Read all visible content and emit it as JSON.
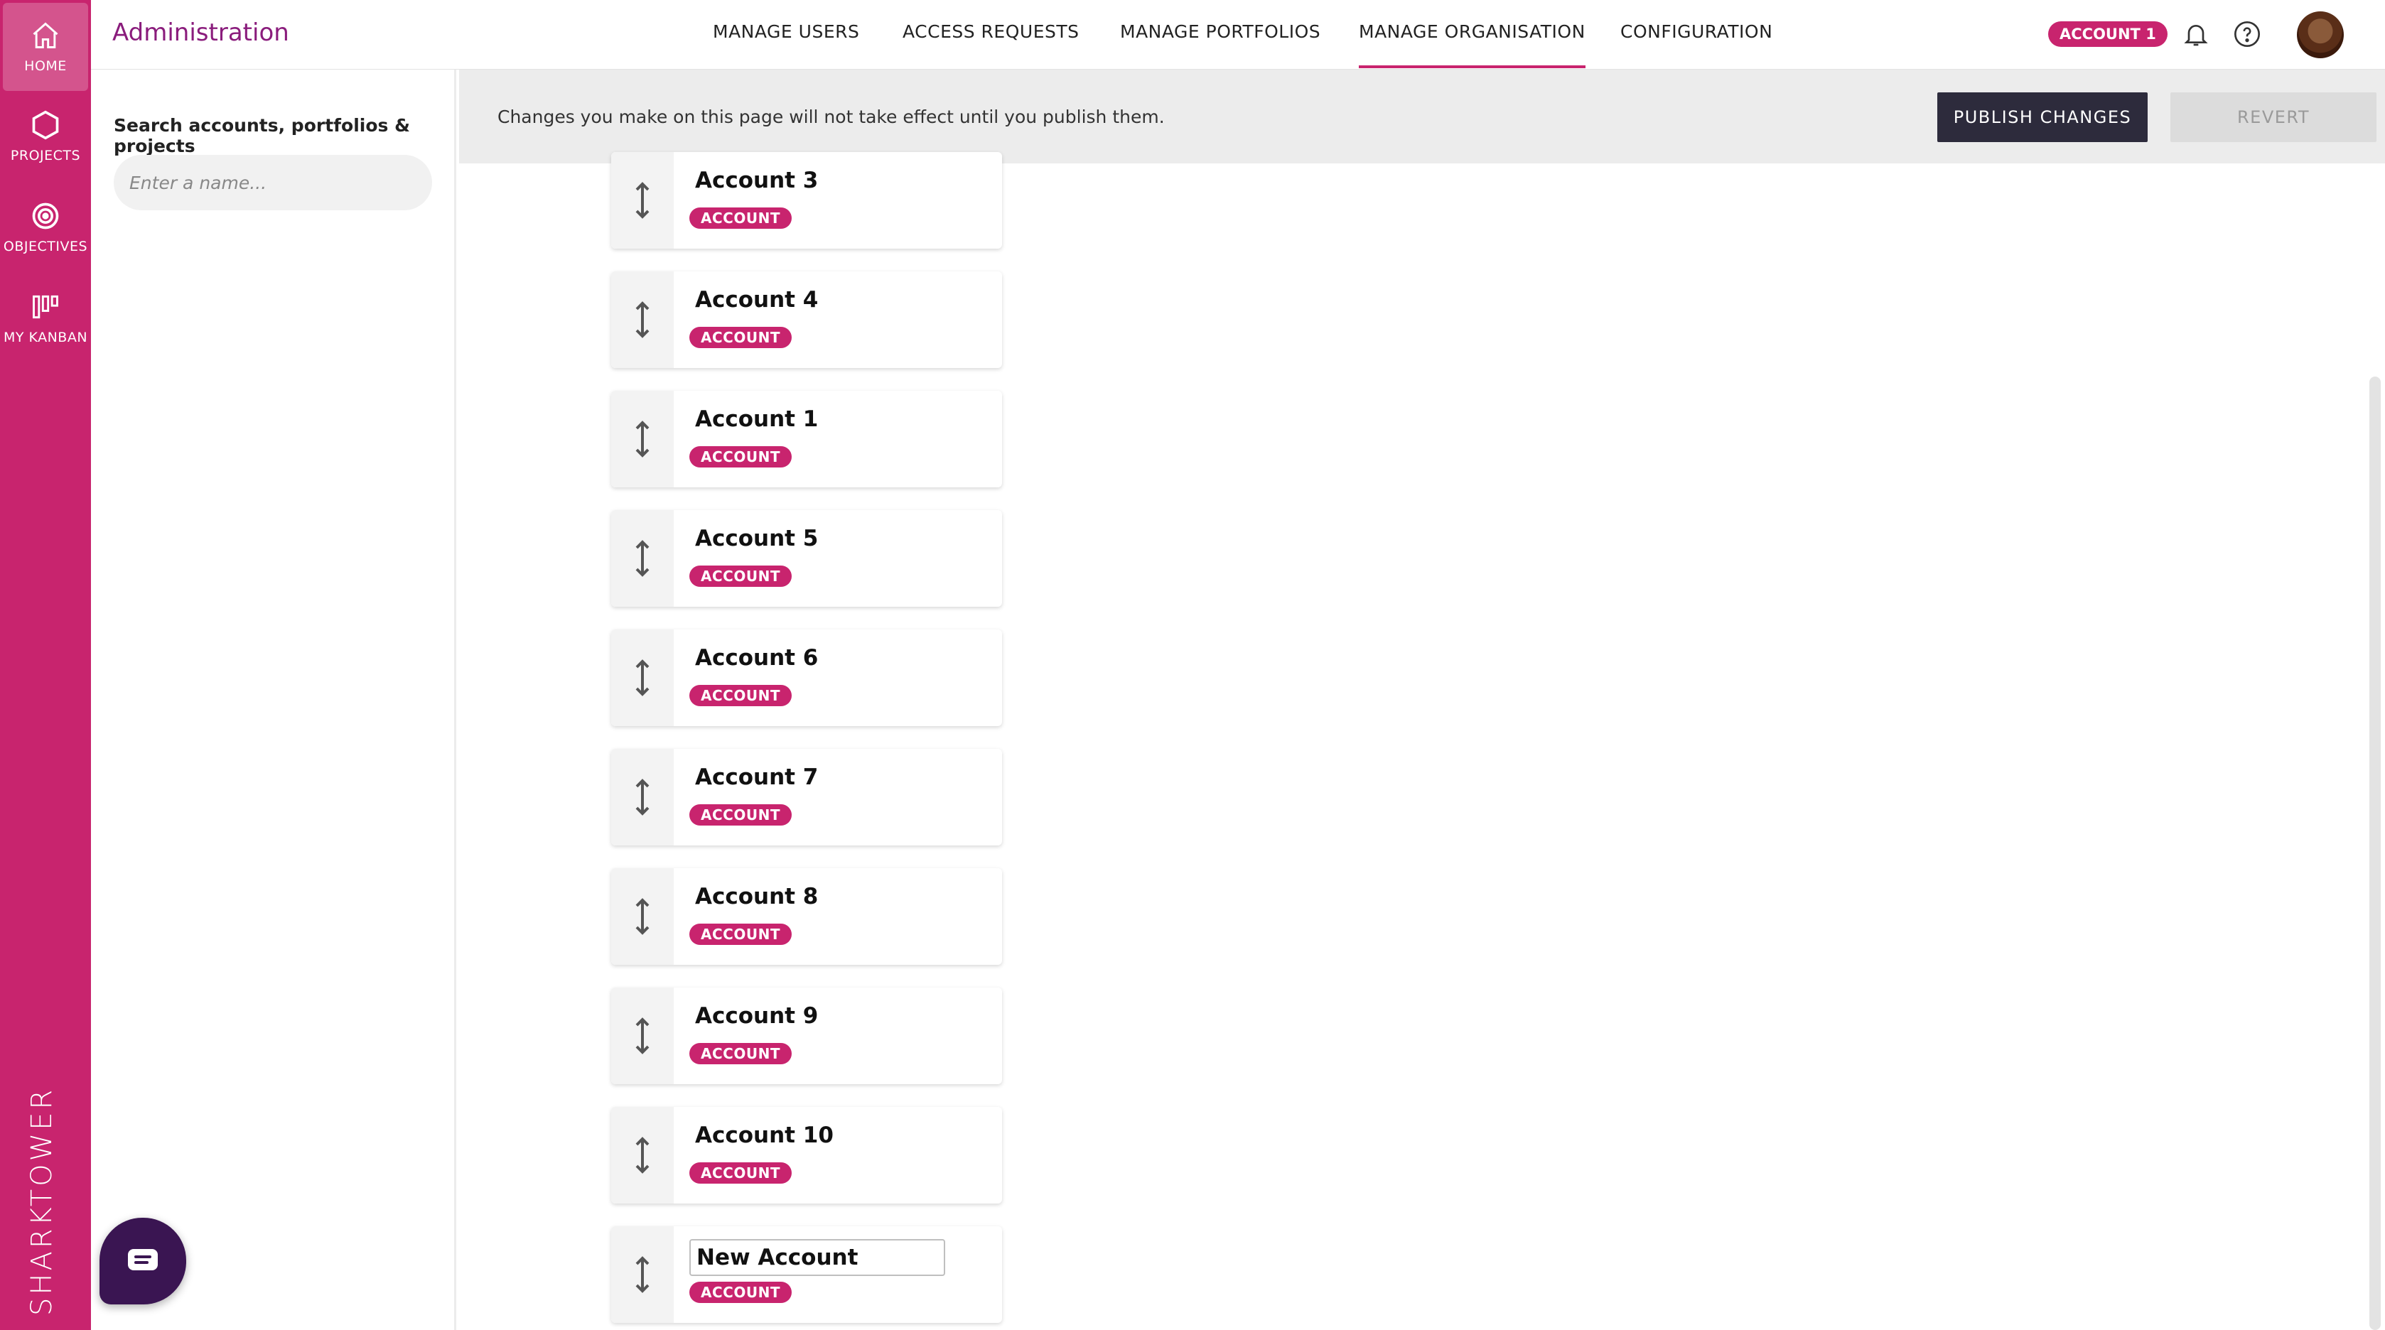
{
  "rail": {
    "items": [
      {
        "label": "HOME",
        "icon": "home-icon"
      },
      {
        "label": "PROJECTS",
        "icon": "hexagon-icon"
      },
      {
        "label": "OBJECTIVES",
        "icon": "target-icon"
      },
      {
        "label": "MY KANBAN",
        "icon": "kanban-icon"
      }
    ],
    "brand": "SHARKTOWER"
  },
  "header": {
    "title": "Administration",
    "nav": [
      {
        "label": "MANAGE USERS"
      },
      {
        "label": "ACCESS REQUESTS"
      },
      {
        "label": "MANAGE PORTFOLIOS"
      },
      {
        "label": "MANAGE ORGANISATION"
      },
      {
        "label": "CONFIGURATION"
      }
    ],
    "account_pill": "ACCOUNT 1"
  },
  "search": {
    "label": "Search accounts, portfolios & projects",
    "placeholder": "Enter a name..."
  },
  "notice": {
    "text": "Changes you make on this page will not take effect until you publish them.",
    "publish_label": "PUBLISH CHANGES",
    "revert_label": "REVERT"
  },
  "cards": [
    {
      "name": "Account 3",
      "badge": "ACCOUNT"
    },
    {
      "name": "Account 4",
      "badge": "ACCOUNT"
    },
    {
      "name": "Account 1",
      "badge": "ACCOUNT"
    },
    {
      "name": "Account 5",
      "badge": "ACCOUNT"
    },
    {
      "name": "Account 6",
      "badge": "ACCOUNT"
    },
    {
      "name": "Account 7",
      "badge": "ACCOUNT"
    },
    {
      "name": "Account 8",
      "badge": "ACCOUNT"
    },
    {
      "name": "Account 9",
      "badge": "ACCOUNT"
    },
    {
      "name": "Account 10",
      "badge": "ACCOUNT"
    }
  ],
  "new_card": {
    "value": "New Account",
    "badge": "ACCOUNT"
  },
  "colors": {
    "brand": "#c8246e",
    "title": "#8a1c7c",
    "publish": "#2d2b3c",
    "chat": "#3a1552"
  }
}
